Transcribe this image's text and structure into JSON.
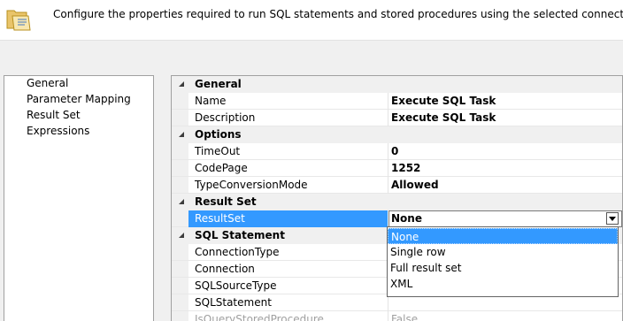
{
  "header": {
    "description": "Configure the properties required to run SQL statements and stored procedures using the selected connection.",
    "icon": "folder-script-icon"
  },
  "nav": {
    "items": [
      {
        "label": "General"
      },
      {
        "label": "Parameter Mapping"
      },
      {
        "label": "Result Set"
      },
      {
        "label": "Expressions"
      }
    ]
  },
  "grid": {
    "categories": {
      "general": "General",
      "options": "Options",
      "result_set": "Result Set",
      "sql_statement": "SQL Statement"
    },
    "props": {
      "name": {
        "label": "Name",
        "value": "Execute SQL Task"
      },
      "description": {
        "label": "Description",
        "value": "Execute SQL Task"
      },
      "timeout": {
        "label": "TimeOut",
        "value": "0"
      },
      "codepage": {
        "label": "CodePage",
        "value": "1252"
      },
      "type_conversion": {
        "label": "TypeConversionMode",
        "value": "Allowed"
      },
      "resultset": {
        "label": "ResultSet",
        "value": "None"
      },
      "connection_type": {
        "label": "ConnectionType",
        "value": ""
      },
      "connection": {
        "label": "Connection",
        "value": ""
      },
      "sql_source_type": {
        "label": "SQLSourceType",
        "value": ""
      },
      "sql_statement": {
        "label": "SQLStatement",
        "value": ""
      },
      "is_query_sp": {
        "label": "IsQueryStoredProcedure",
        "value": "False"
      }
    }
  },
  "dropdown": {
    "options": [
      "None",
      "Single row",
      "Full result set",
      "XML"
    ],
    "selected": "None"
  },
  "colors": {
    "selection": "#3399ff",
    "category_bg": "#f0f0f0"
  }
}
